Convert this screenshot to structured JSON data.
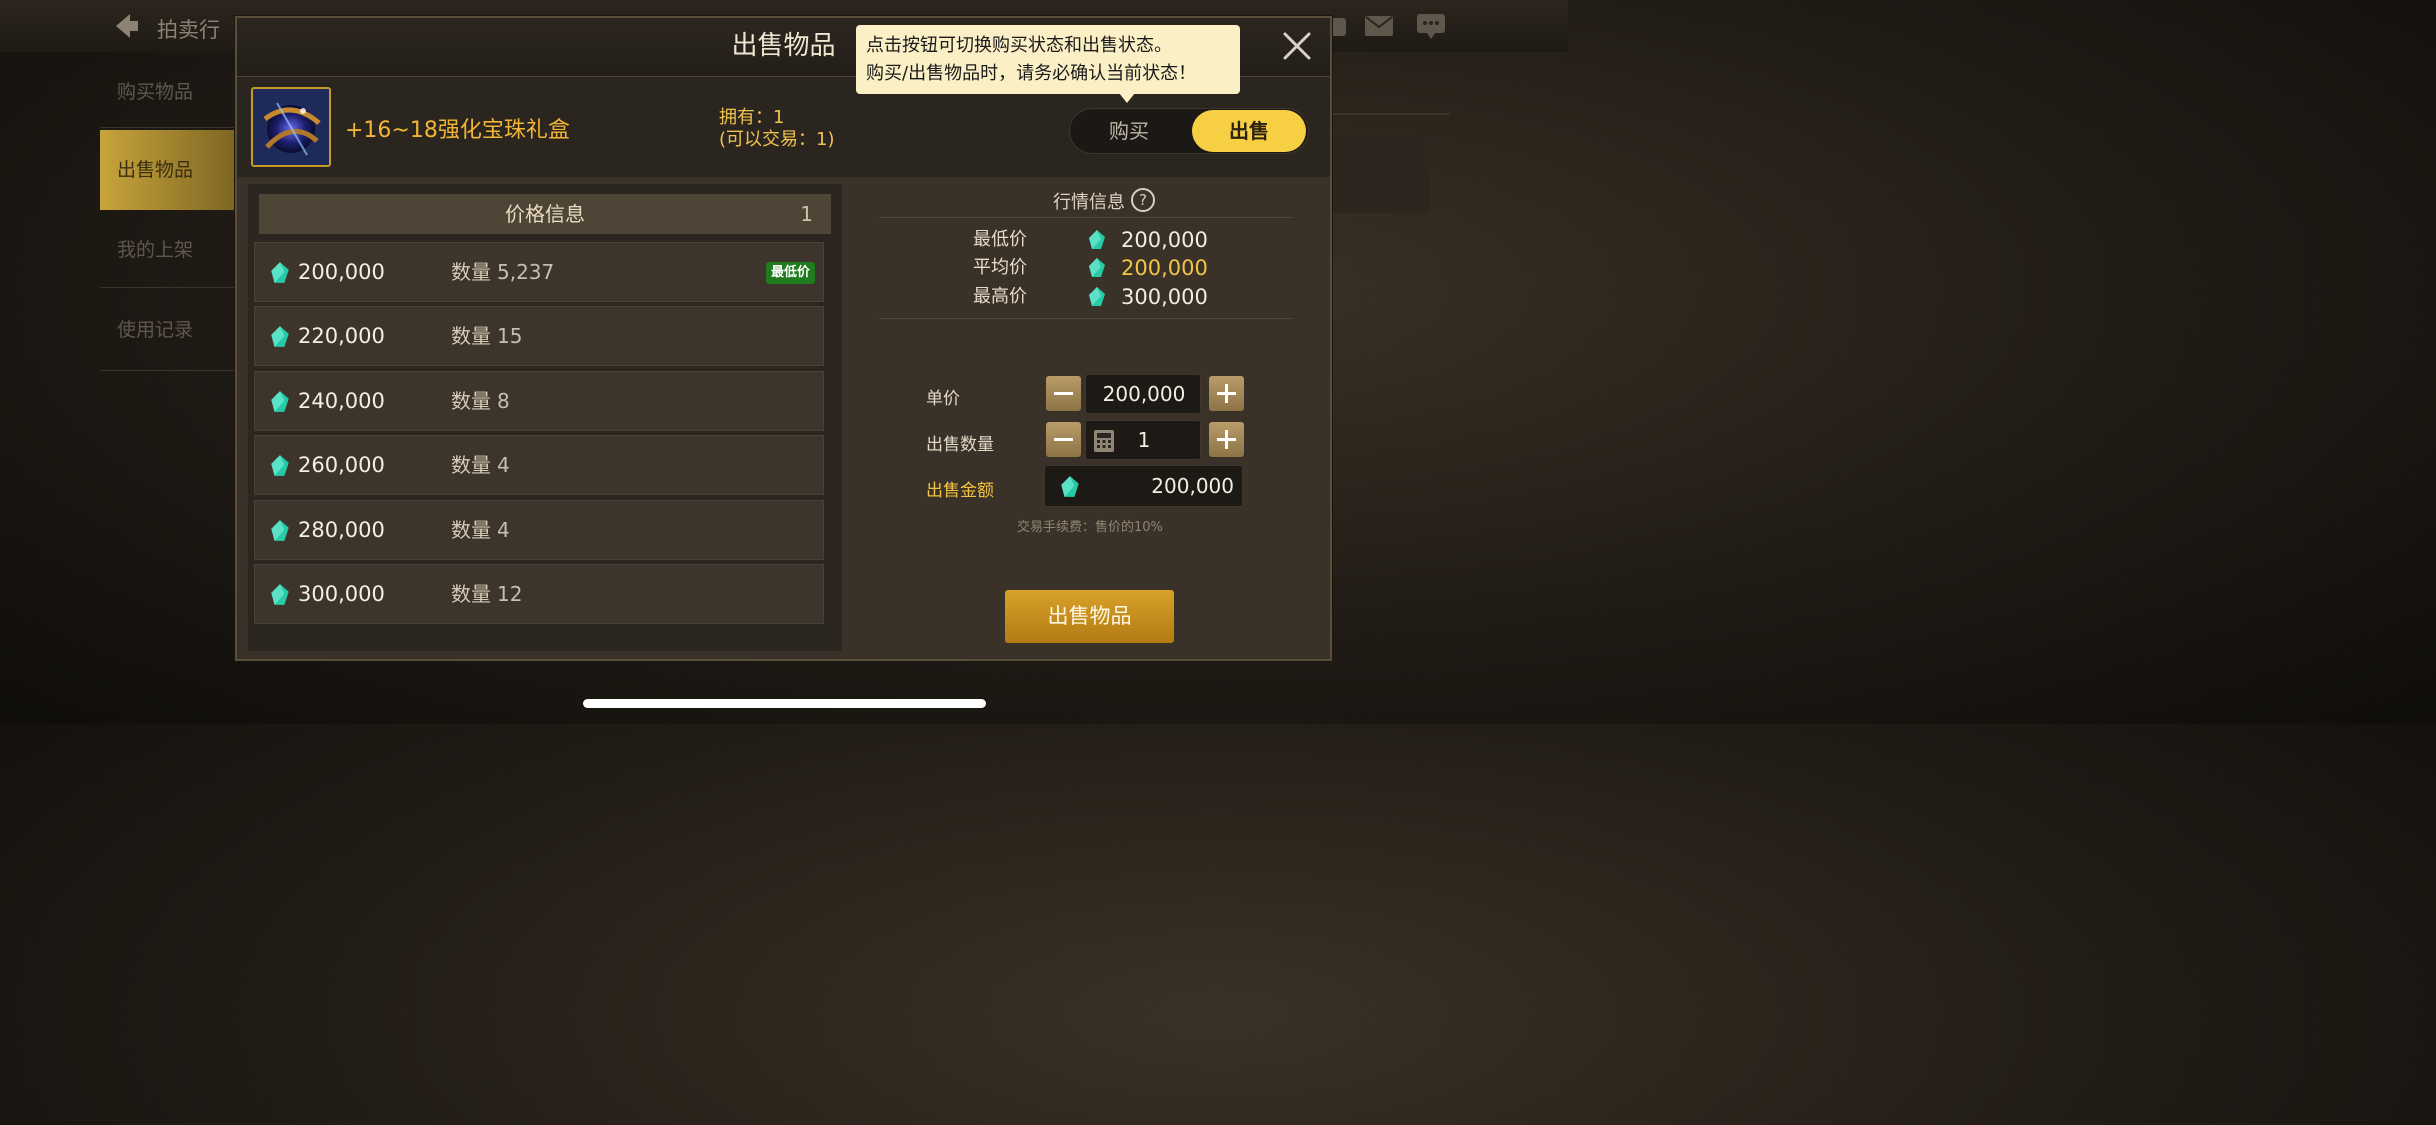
{
  "background": {
    "title": "拍卖行",
    "side_items": [
      "购买物品",
      "出售物品",
      "我的上架",
      "使用记录"
    ]
  },
  "modal": {
    "title": "出售物品",
    "tooltip": [
      "点击按钮可切换购买状态和出售状态。",
      "购买/出售物品时，请务必确认当前状态！"
    ]
  },
  "item": {
    "name": "+16~18强化宝珠礼盒",
    "owned": "拥有：1",
    "tradable": "(可以交易：1)"
  },
  "toggle": {
    "buy": "购买",
    "sell": "出售",
    "selected": "出售"
  },
  "price_info": {
    "title": "价格信息",
    "page": "1",
    "qty_label": "数量",
    "lowest_badge": "最低价",
    "rows": [
      {
        "price": "200,000",
        "qty": "5,237"
      },
      {
        "price": "220,000",
        "qty": "15"
      },
      {
        "price": "240,000",
        "qty": "8"
      },
      {
        "price": "260,000",
        "qty": "4"
      },
      {
        "price": "280,000",
        "qty": "4"
      },
      {
        "price": "300,000",
        "qty": "12"
      }
    ]
  },
  "market": {
    "title": "行情信息",
    "min_label": "最低价",
    "min_value": "200,000",
    "avg_label": "平均价",
    "avg_value": "200,000",
    "max_label": "最高价",
    "max_value": "300,000"
  },
  "form": {
    "unit_price_label": "单价",
    "unit_price": "200,000",
    "qty_label": "出售数量",
    "qty": "1",
    "total_label": "出售金额",
    "total": "200,000",
    "fee_note": "交易手续费：售价的10%",
    "submit": "出售物品"
  },
  "colors": {
    "accent": "#f6cf43",
    "gem": "#2fd8b0",
    "badge": "#1e7c1e"
  }
}
